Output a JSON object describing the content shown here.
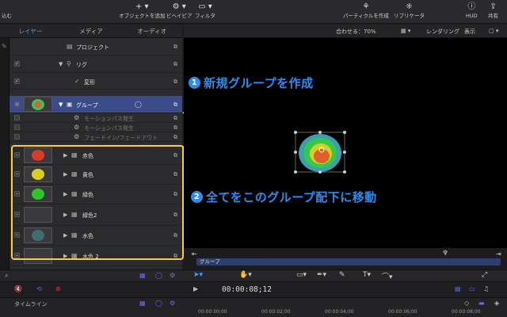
{
  "toolbar": {
    "partial_left": "込む",
    "add_object": "オブジェクトを追加",
    "preview": "ビヘイビア",
    "filter": "フィルタ",
    "particle": "パーティクルを作成",
    "replicate": "リプリケータ",
    "hud": "HUD",
    "share": "共有"
  },
  "tabs": [
    "レイヤー",
    "メディア",
    "オーディオ"
  ],
  "active_tab": "レイヤー",
  "layers": [
    {
      "label": "プロジェクト",
      "icon": "document-icon"
    },
    {
      "label": "リグ",
      "icon": "rig-icon"
    },
    {
      "label": "変形",
      "icon": "transform-icon"
    },
    {
      "label": "グループ",
      "icon": "group-icon",
      "selected": true
    },
    {
      "label": "モーションパス発生",
      "icon": "behavior-icon"
    },
    {
      "label": "モーションパス発生",
      "icon": "behavior-icon"
    },
    {
      "label": "フェードイン/フェードアウト",
      "icon": "behavior-icon"
    },
    {
      "label": "赤色",
      "color": "#d93a2b"
    },
    {
      "label": "黄色",
      "color": "#d8cf22"
    },
    {
      "label": "緑色",
      "color": "#2ec52c"
    },
    {
      "label": "緑色2",
      "color": ""
    },
    {
      "label": "水色",
      "color": "#3f6f73"
    },
    {
      "label": "水色 2",
      "color": ""
    }
  ],
  "canvas_header": {
    "fit": "合わせる：70%",
    "render": "レンダリング",
    "view": "表示"
  },
  "annotations": [
    {
      "num": "1",
      "text": "新規グループを作成"
    },
    {
      "num": "2",
      "text": "全てをこのグループ配下に移動"
    }
  ],
  "group_bar": "グループ",
  "timecode": "00:00:08;12",
  "timeline_label": "タイムライン",
  "timeline_ticks": [
    "00:00:00;00",
    "00:00:02;00",
    "00:00:04;00",
    "00:00:06;00",
    "00:00:08;00"
  ],
  "colors": {
    "accent": "#2e8cf0",
    "highlight": "#f4cf3c",
    "selected_row": "#3b4b8a"
  }
}
